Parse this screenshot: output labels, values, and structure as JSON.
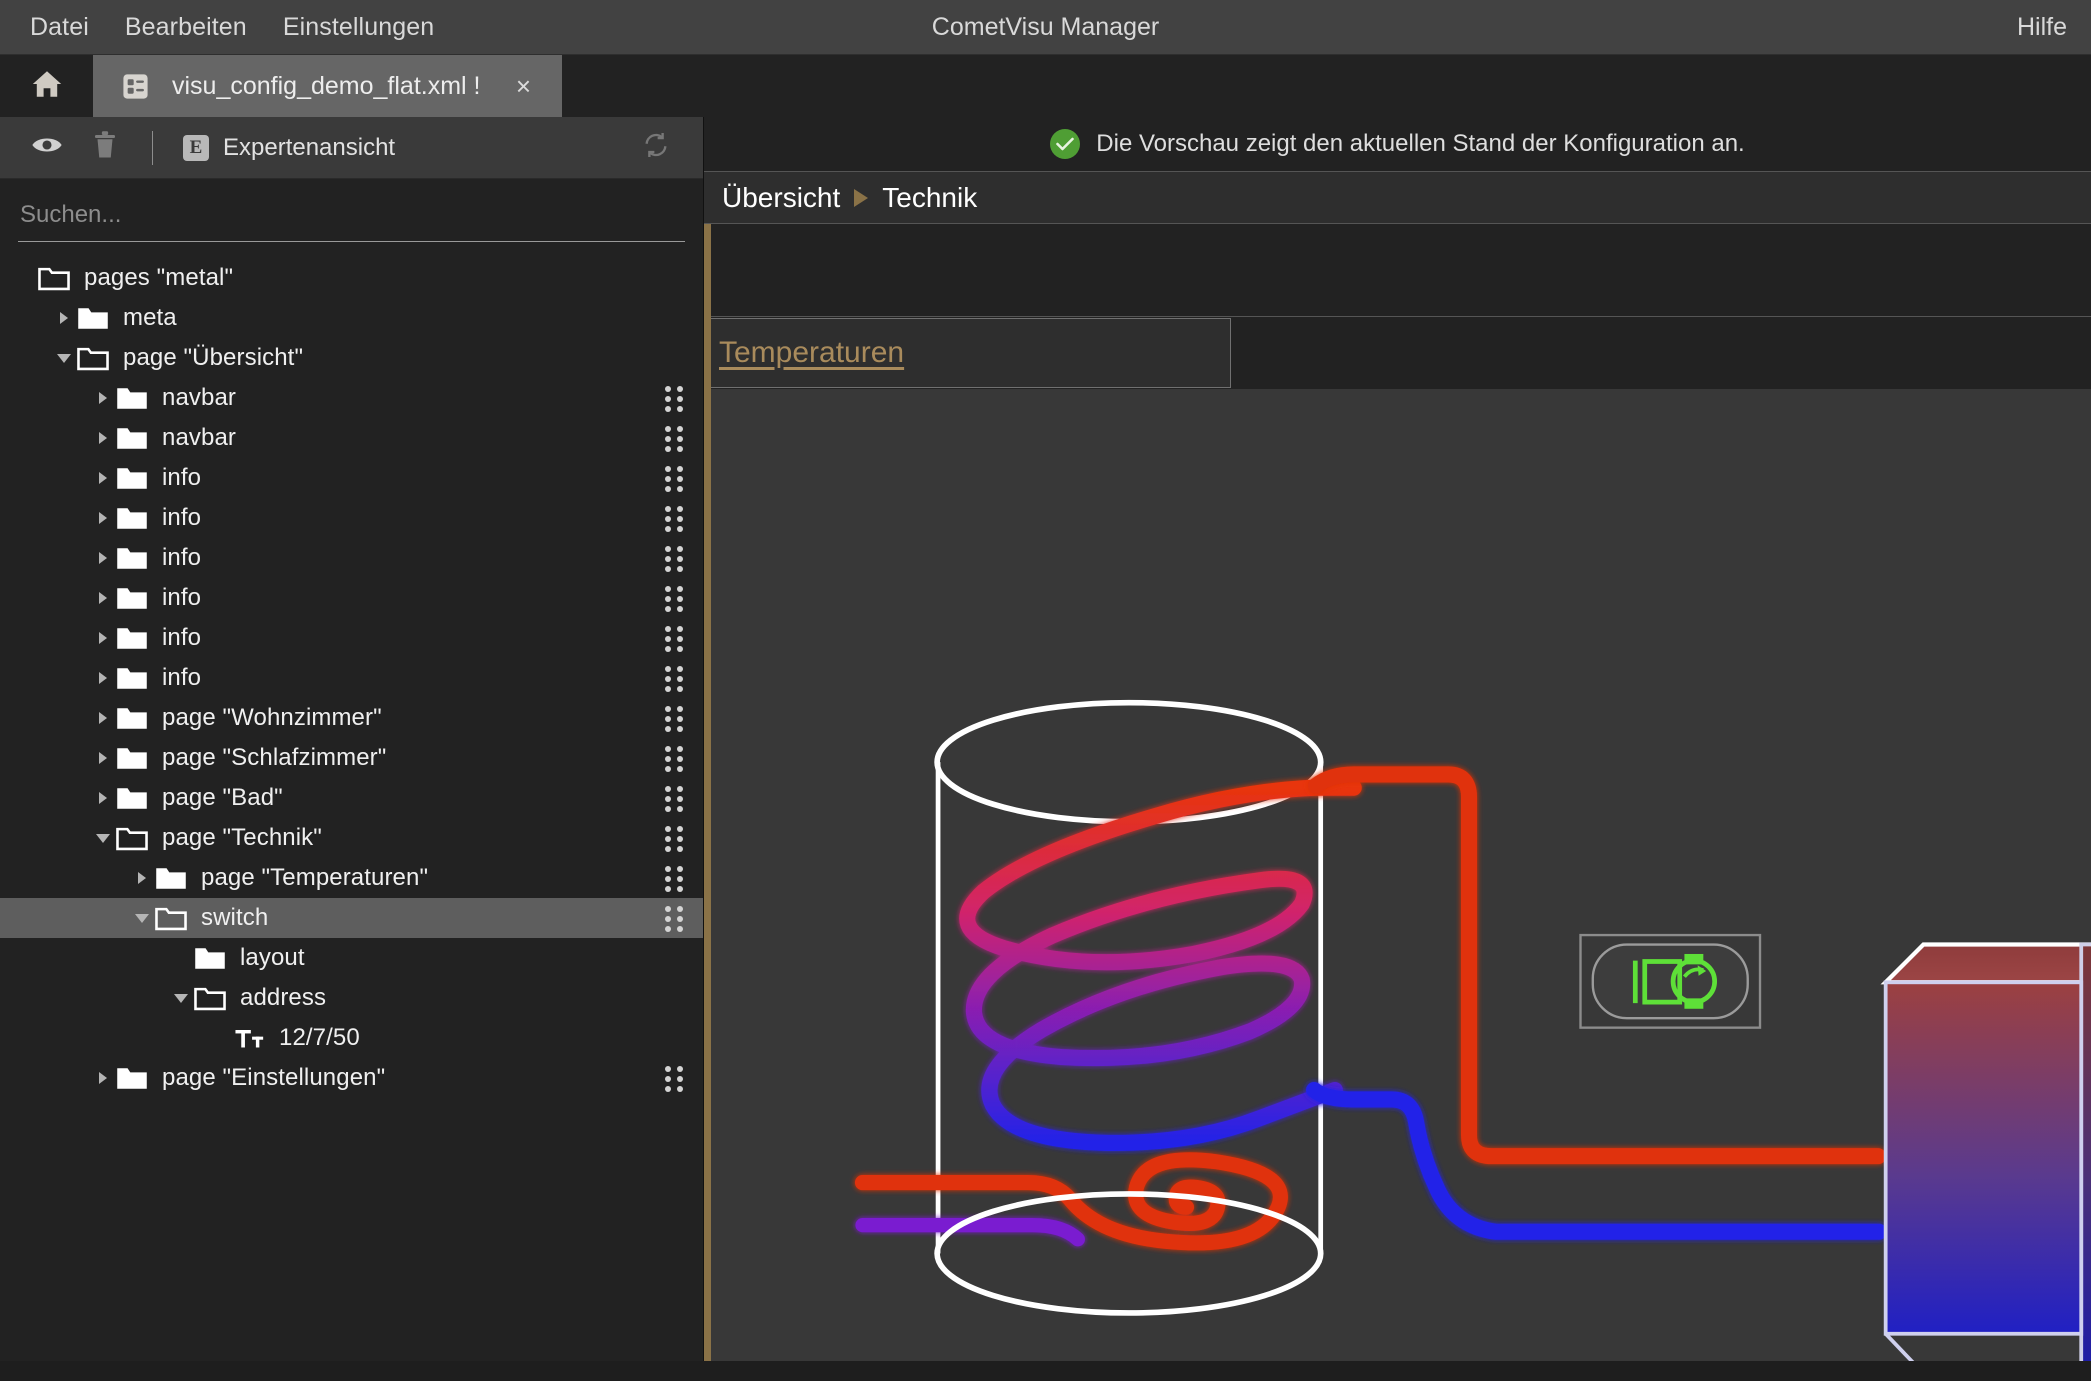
{
  "window": {
    "title": "CometVisu Manager",
    "help_label": "Hilfe",
    "menu": [
      {
        "label": "Datei",
        "name": "menu-datei"
      },
      {
        "label": "Bearbeiten",
        "name": "menu-bearbeiten"
      },
      {
        "label": "Einstellungen",
        "name": "menu-einstellungen"
      }
    ]
  },
  "tabbar": {
    "home_icon": "home-icon",
    "tabs": [
      {
        "label": "visu_config_demo_flat.xml !",
        "icon": "config-file-icon",
        "close": "×"
      }
    ]
  },
  "sidebar": {
    "toolbar": {
      "preview_icon": "eye-icon",
      "delete_icon": "trash-icon",
      "expert_badge": "E",
      "expert_label": "Expertenansicht",
      "refresh_icon": "refresh-icon"
    },
    "search": {
      "placeholder": "Suchen...",
      "value": ""
    },
    "tree": [
      {
        "label": "pages \"metal\"",
        "depth": 0,
        "twisty": "none",
        "folder": "open",
        "handle": false,
        "selected": false
      },
      {
        "label": "meta",
        "depth": 1,
        "twisty": "closed",
        "folder": "closed",
        "handle": false,
        "selected": false
      },
      {
        "label": "page \"Übersicht\"",
        "depth": 1,
        "twisty": "open",
        "folder": "open",
        "handle": false,
        "selected": false
      },
      {
        "label": "navbar",
        "depth": 2,
        "twisty": "closed",
        "folder": "closed",
        "handle": true,
        "selected": false
      },
      {
        "label": "navbar",
        "depth": 2,
        "twisty": "closed",
        "folder": "closed",
        "handle": true,
        "selected": false
      },
      {
        "label": "info",
        "depth": 2,
        "twisty": "closed",
        "folder": "closed",
        "handle": true,
        "selected": false
      },
      {
        "label": "info",
        "depth": 2,
        "twisty": "closed",
        "folder": "closed",
        "handle": true,
        "selected": false
      },
      {
        "label": "info",
        "depth": 2,
        "twisty": "closed",
        "folder": "closed",
        "handle": true,
        "selected": false
      },
      {
        "label": "info",
        "depth": 2,
        "twisty": "closed",
        "folder": "closed",
        "handle": true,
        "selected": false
      },
      {
        "label": "info",
        "depth": 2,
        "twisty": "closed",
        "folder": "closed",
        "handle": true,
        "selected": false
      },
      {
        "label": "info",
        "depth": 2,
        "twisty": "closed",
        "folder": "closed",
        "handle": true,
        "selected": false
      },
      {
        "label": "page \"Wohnzimmer\"",
        "depth": 2,
        "twisty": "closed",
        "folder": "closed",
        "handle": true,
        "selected": false
      },
      {
        "label": "page \"Schlafzimmer\"",
        "depth": 2,
        "twisty": "closed",
        "folder": "closed",
        "handle": true,
        "selected": false
      },
      {
        "label": "page \"Bad\"",
        "depth": 2,
        "twisty": "closed",
        "folder": "closed",
        "handle": true,
        "selected": false
      },
      {
        "label": "page \"Technik\"",
        "depth": 2,
        "twisty": "open",
        "folder": "open",
        "handle": true,
        "selected": false
      },
      {
        "label": "page \"Temperaturen\"",
        "depth": 3,
        "twisty": "closed",
        "folder": "closed",
        "handle": true,
        "selected": false
      },
      {
        "label": "switch",
        "depth": 3,
        "twisty": "open",
        "folder": "open",
        "handle": true,
        "selected": true
      },
      {
        "label": "layout",
        "depth": 4,
        "twisty": "none",
        "folder": "closed",
        "handle": false,
        "selected": false
      },
      {
        "label": "address",
        "depth": 4,
        "twisty": "open",
        "folder": "open",
        "handle": false,
        "selected": false
      },
      {
        "label": "12/7/50",
        "depth": 5,
        "twisty": "none",
        "folder": "text",
        "handle": false,
        "selected": false
      },
      {
        "label": "page \"Einstellungen\"",
        "depth": 2,
        "twisty": "closed",
        "folder": "closed",
        "handle": true,
        "selected": false
      }
    ]
  },
  "preview": {
    "status_text": "Die Vorschau zeigt den aktuellen Stand der Konfiguration an.",
    "status_icon": "check-circle-icon",
    "breadcrumb": [
      "Übersicht",
      "Technik"
    ],
    "link": {
      "label": "Temperaturen"
    },
    "pump_widget": {
      "icon": "pump-icon",
      "color": "#5ee038"
    },
    "colors": {
      "hot_pipe": "#e03c12",
      "cold_pipe": "#2a2ae0",
      "mid_pipe": "#8b1fb0",
      "accent": "#8a7247",
      "link": "#a98b5c",
      "tank_outline": "#ffffff",
      "radiator_top": "#9c4040",
      "radiator_bottom": "#2b2bbe",
      "canvas_bg": "#383838"
    }
  }
}
